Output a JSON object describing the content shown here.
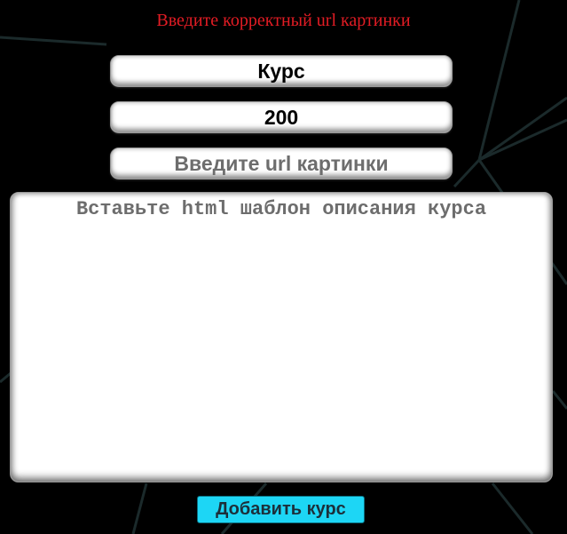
{
  "error_message": "Введите корректный url картинки",
  "form": {
    "name_value": "Курс",
    "price_value": "200",
    "image_url_placeholder": "Введите url картинки",
    "template_placeholder": "Вставьте html шаблон описания курса",
    "submit_label": "Добавить курс"
  },
  "colors": {
    "background": "#000000",
    "error_text": "#e21c24",
    "button_accent": "#1dd6f5",
    "placeholder_text": "#6d6d6d",
    "background_lines": "#1b2a2b"
  }
}
